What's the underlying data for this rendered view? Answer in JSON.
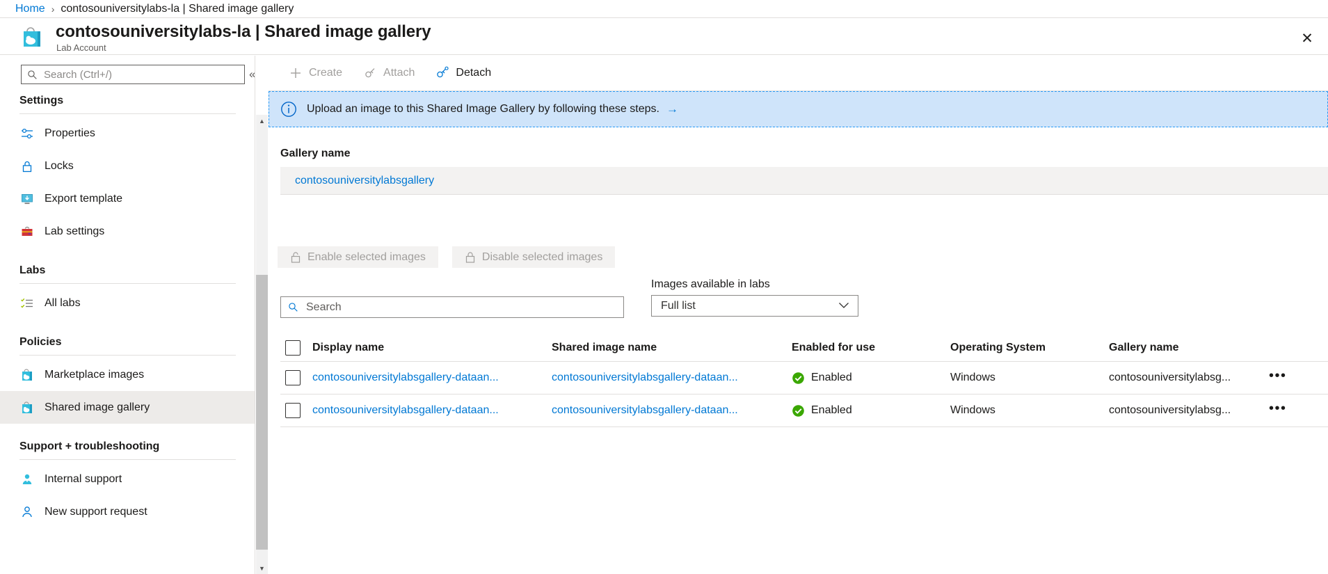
{
  "breadcrumb": {
    "home": "Home",
    "separator": "›",
    "current": "contosouniversitylabs-la | Shared image gallery"
  },
  "header": {
    "title": "contosouniversitylabs-la | Shared image gallery",
    "subtitle": "Lab Account",
    "close_label": "✕"
  },
  "sidebar": {
    "search_placeholder": "Search (Ctrl+/)",
    "search_value": "",
    "collapse_label": "«",
    "groups": [
      {
        "title": "Settings",
        "items": [
          {
            "label": "Properties",
            "icon": "sliders-icon"
          },
          {
            "label": "Locks",
            "icon": "lock-icon"
          },
          {
            "label": "Export template",
            "icon": "export-template-icon"
          },
          {
            "label": "Lab settings",
            "icon": "briefcase-icon"
          }
        ]
      },
      {
        "title": "Labs",
        "items": [
          {
            "label": "All labs",
            "icon": "checklist-icon"
          }
        ]
      },
      {
        "title": "Policies",
        "items": [
          {
            "label": "Marketplace images",
            "icon": "marketplace-bag-icon"
          },
          {
            "label": "Shared image gallery",
            "icon": "gallery-bag-icon"
          }
        ]
      },
      {
        "title": "Support + troubleshooting",
        "items": [
          {
            "label": "Internal support",
            "icon": "person-support-icon"
          },
          {
            "label": "New support request",
            "icon": "person-outline-icon"
          }
        ]
      }
    ],
    "selected_item": "Shared image gallery"
  },
  "toolbar": {
    "create_label": "Create",
    "attach_label": "Attach",
    "detach_label": "Detach"
  },
  "info_banner": {
    "text": "Upload an image to this Shared Image Gallery by following these steps.",
    "arrow": "→"
  },
  "gallery": {
    "section_label": "Gallery name",
    "name": "contosouniversitylabsgallery"
  },
  "actions": {
    "enable_label": "Enable selected images",
    "disable_label": "Disable selected images"
  },
  "filters": {
    "search_placeholder": "Search",
    "search_value": "",
    "dropdown_label": "Images available in labs",
    "dropdown_value": "Full list",
    "dropdown_chevron": "∨"
  },
  "table": {
    "columns": [
      "Display name",
      "Shared image name",
      "Enabled for use",
      "Operating System",
      "Gallery name"
    ],
    "rows": [
      {
        "display_name": "contosouniversitylabsgallery-dataan...",
        "shared_image_name": "contosouniversitylabsgallery-dataan...",
        "enabled": "Enabled",
        "os": "Windows",
        "gallery_name": "contosouniversitylabsg...",
        "menu": "•••"
      },
      {
        "display_name": "contosouniversitylabsgallery-dataan...",
        "shared_image_name": "contosouniversitylabsgallery-dataan...",
        "enabled": "Enabled",
        "os": "Windows",
        "gallery_name": "contosouniversitylabsg...",
        "menu": "•••"
      }
    ]
  },
  "colors": {
    "accent": "#0078d4",
    "banner_bg": "#cfe4fa",
    "banner_border": "#2899f5",
    "enabled_green": "#3aa700",
    "selected_bg": "#edebe9"
  }
}
